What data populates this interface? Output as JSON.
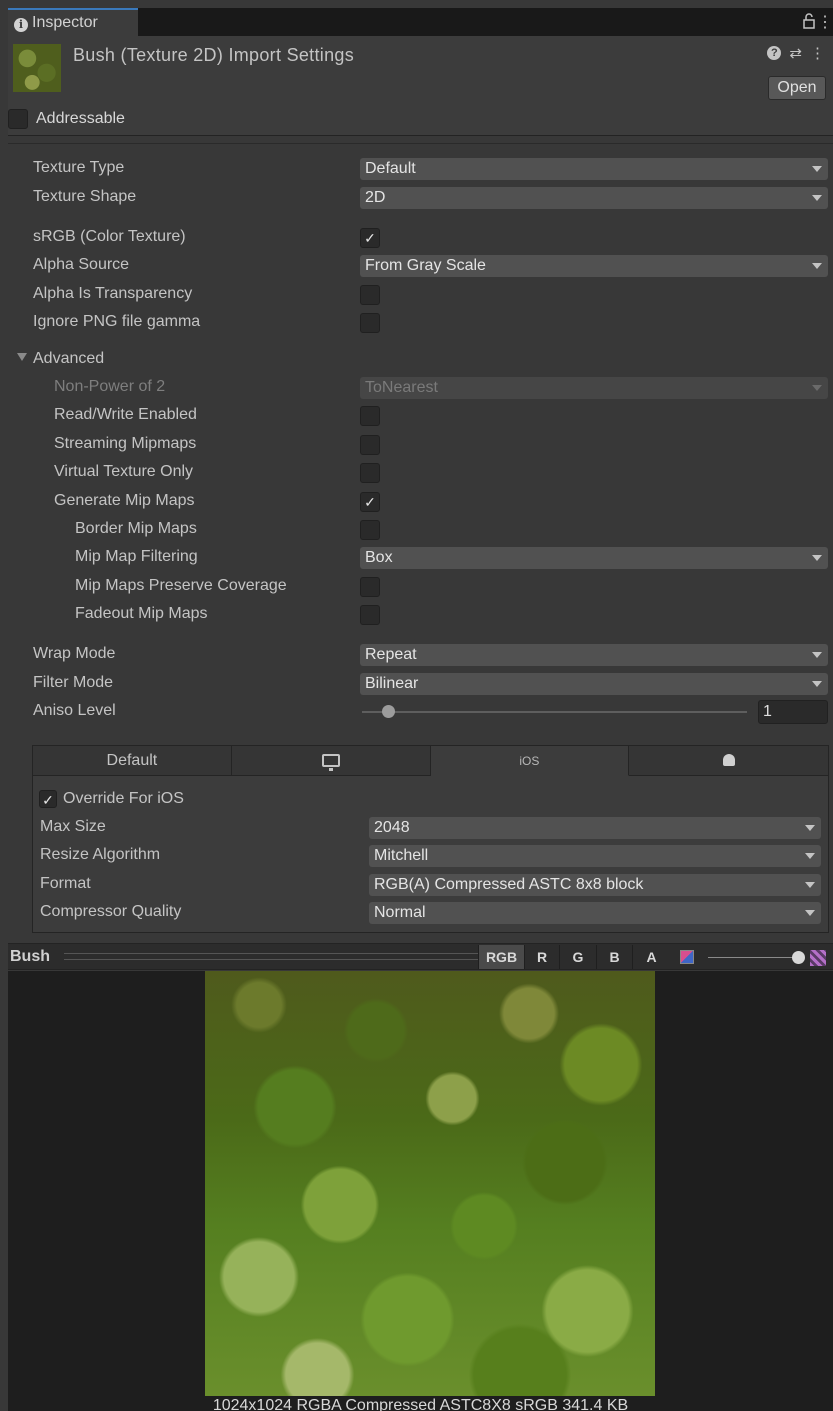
{
  "window": {
    "tab_label": "Inspector",
    "more_glyph": "⋮"
  },
  "header": {
    "title": "Bush (Texture 2D) Import Settings",
    "help_glyph": "?",
    "presets_glyph": "⇄",
    "more_glyph": "⋮",
    "open_label": "Open",
    "addressable_label": "Addressable",
    "addressable_checked": false
  },
  "properties": {
    "texture_type": {
      "label": "Texture Type",
      "value": "Default"
    },
    "texture_shape": {
      "label": "Texture Shape",
      "value": "2D"
    },
    "srgb": {
      "label": "sRGB (Color Texture)",
      "checked": true,
      "mark": "✓"
    },
    "alpha_source": {
      "label": "Alpha Source",
      "value": "From Gray Scale"
    },
    "alpha_is_transparency": {
      "label": "Alpha Is Transparency",
      "checked": false
    },
    "ignore_png_gamma": {
      "label": "Ignore PNG file gamma",
      "checked": false
    }
  },
  "advanced": {
    "label": "Advanced",
    "non_power_of_2": {
      "label": "Non-Power of 2",
      "value": "ToNearest"
    },
    "read_write": {
      "label": "Read/Write Enabled",
      "checked": false
    },
    "streaming_mipmaps": {
      "label": "Streaming Mipmaps",
      "checked": false
    },
    "virtual_texture_only": {
      "label": "Virtual Texture Only",
      "checked": false
    },
    "generate_mip_maps": {
      "label": "Generate Mip Maps",
      "checked": true,
      "mark": "✓"
    },
    "border_mip_maps": {
      "label": "Border Mip Maps",
      "checked": false
    },
    "mip_map_filtering": {
      "label": "Mip Map Filtering",
      "value": "Box"
    },
    "mip_maps_preserve_coverage": {
      "label": "Mip Maps Preserve Coverage",
      "checked": false
    },
    "fadeout_mip_maps": {
      "label": "Fadeout Mip Maps",
      "checked": false
    }
  },
  "sampling": {
    "wrap_mode": {
      "label": "Wrap Mode",
      "value": "Repeat"
    },
    "filter_mode": {
      "label": "Filter Mode",
      "value": "Bilinear"
    },
    "aniso_level": {
      "label": "Aniso Level",
      "value": "1"
    }
  },
  "platform": {
    "tabs": [
      {
        "label": "Default",
        "icon": null
      },
      {
        "label": "",
        "icon": "monitor-icon"
      },
      {
        "label": "iOS",
        "icon": null
      },
      {
        "label": "",
        "icon": "android-icon"
      }
    ],
    "active_tab": "iOS",
    "override": {
      "label": "Override For iOS",
      "checked": true,
      "mark": "✓"
    },
    "max_size": {
      "label": "Max Size",
      "value": "2048"
    },
    "resize_algorithm": {
      "label": "Resize Algorithm",
      "value": "Mitchell"
    },
    "format": {
      "label": "Format",
      "value": "RGB(A) Compressed ASTC 8x8 block"
    },
    "compressor_quality": {
      "label": "Compressor Quality",
      "value": "Normal"
    }
  },
  "preview": {
    "name": "Bush",
    "channels": [
      "RGB",
      "R",
      "G",
      "B",
      "A"
    ],
    "active_channel": "RGB",
    "info": "1024x1024  RGBA Compressed ASTC8X8 sRGB  341.4 KB"
  }
}
